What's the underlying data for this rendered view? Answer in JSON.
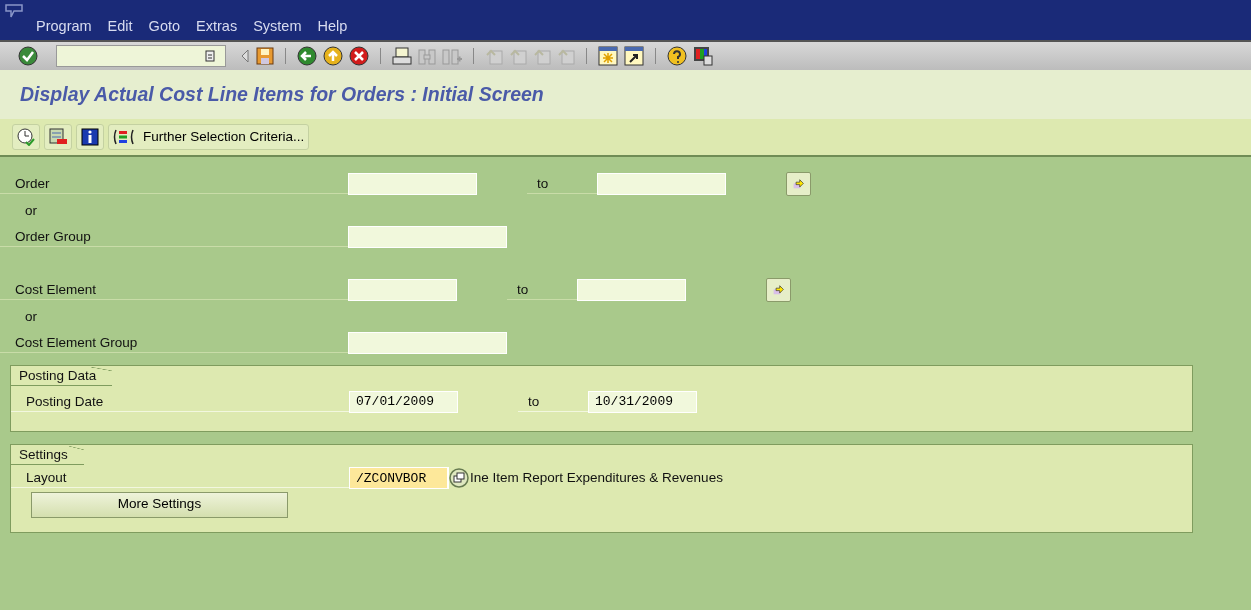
{
  "menu": [
    {
      "label": "Program"
    },
    {
      "label": "Edit"
    },
    {
      "label": "Goto"
    },
    {
      "label": "Extras"
    },
    {
      "label": "System"
    },
    {
      "label": "Help"
    }
  ],
  "title": "Display Actual Cost Line Items for Orders : Initial Screen",
  "app_toolbar": {
    "button": "Further Selection Criteria..."
  },
  "selection": [
    {
      "kind": "range",
      "label": "Order",
      "to_label": "to"
    },
    {
      "kind": "note",
      "text": "or"
    },
    {
      "kind": "single",
      "label": "Order Group"
    },
    {
      "kind": "gap"
    },
    {
      "kind": "range",
      "label": "Cost Element",
      "to_label": "to"
    },
    {
      "kind": "note",
      "text": "or"
    },
    {
      "kind": "single",
      "label": "Cost Element Group"
    }
  ],
  "posting_data": {
    "title": "Posting Data",
    "label": "Posting Date",
    "from": "07/01/2009",
    "to_label": "to",
    "to": "10/31/2009"
  },
  "settings": {
    "title": "Settings",
    "label": "Layout",
    "value": "/ZCONVBOR",
    "focused": true,
    "description": "Ine Item Report Expenditures & Revenues",
    "button": "More Settings"
  }
}
